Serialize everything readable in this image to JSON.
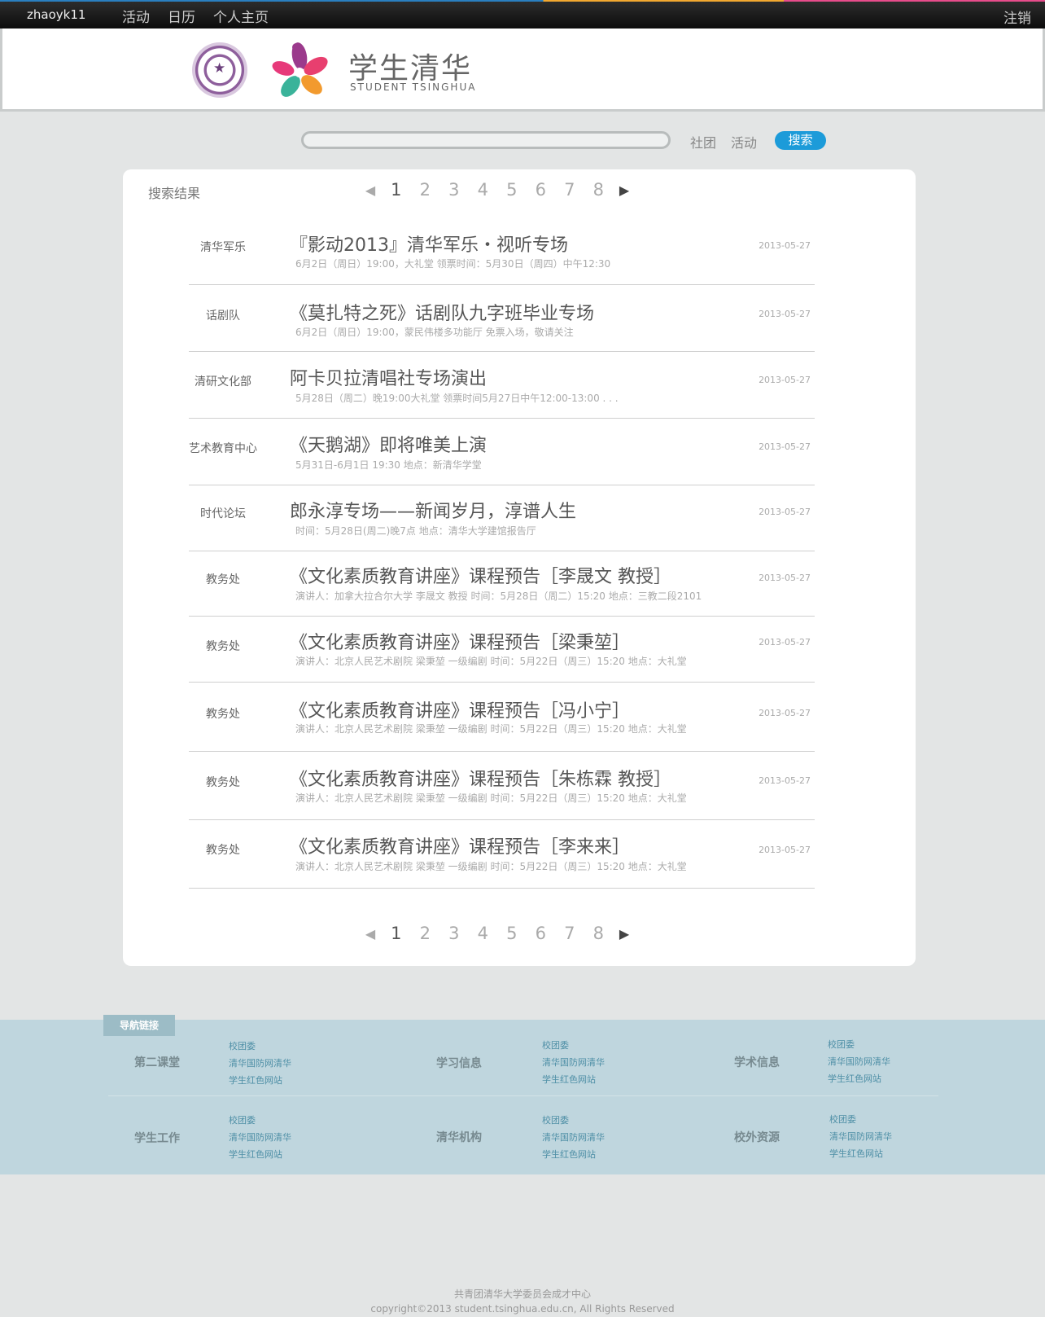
{
  "topbar": {
    "username": "zhaoyk11",
    "nav": [
      "活动",
      "日历",
      "个人主页"
    ],
    "logout": "注销"
  },
  "header": {
    "brand_cn": "学生清华",
    "brand_en": "STUDENT TSINGHUA"
  },
  "search": {
    "value": "",
    "options": [
      "社团",
      "活动"
    ],
    "button": "搜索"
  },
  "results_panel": {
    "title": "搜索结果",
    "pager": {
      "prev": "◀",
      "next": "▶",
      "pages": [
        "1",
        "2",
        "3",
        "4",
        "5",
        "6",
        "7",
        "8"
      ],
      "current": "1"
    },
    "items": [
      {
        "org": "清华军乐",
        "title": "『影动2013』清华军乐・视听专场",
        "desc": "6月2日（周日）19:00，大礼堂  领票时间：5月30日（周四）中午12:30",
        "date": "2013-05-27"
      },
      {
        "org": "话剧队",
        "title": "《莫扎特之死》话剧队九字班毕业专场",
        "desc": "6月2日（周日）19:00，蒙民伟楼多功能厅  免票入场，敬请关注",
        "date": "2013-05-27"
      },
      {
        "org": "清研文化部",
        "title": "阿卡贝拉清唱社专场演出",
        "desc": "5月28日（周二）晚19:00大礼堂  领票时间5月27日中午12:00-13:00 . . .",
        "date": "2013-05-27"
      },
      {
        "org": "艺术教育中心",
        "title": "《天鹅湖》即将唯美上演",
        "desc": "5月31日-6月1日  19:30  地点：新清华学堂",
        "date": "2013-05-27"
      },
      {
        "org": "时代论坛",
        "title": "郎永淳专场——新闻岁月，淳谱人生",
        "desc": "时间：5月28日(周二)晚7点    地点：清华大学建馆报告厅",
        "date": "2013-05-27"
      },
      {
        "org": "教务处",
        "title": "《文化素质教育讲座》课程预告［李晟文  教授］",
        "desc": "演讲人：加拿大拉合尔大学  李晟文  教授  时间：5月28日（周二）15:20  地点：三教二段2101",
        "date": "2013-05-27"
      },
      {
        "org": "教务处",
        "title": "《文化素质教育讲座》课程预告［梁秉堃］",
        "desc": "演讲人：北京人民艺术剧院  梁秉堃  一级编剧  时间：5月22日（周三）15:20  地点：大礼堂",
        "date": "2013-05-27"
      },
      {
        "org": "教务处",
        "title": "《文化素质教育讲座》课程预告［冯小宁］",
        "desc": "演讲人：北京人民艺术剧院  梁秉堃  一级编剧  时间：5月22日（周三）15:20  地点：大礼堂",
        "date": "2013-05-27"
      },
      {
        "org": "教务处",
        "title": "《文化素质教育讲座》课程预告［朱栋霖  教授］",
        "desc": "演讲人：北京人民艺术剧院  梁秉堃  一级编剧  时间：5月22日（周三）15:20  地点：大礼堂",
        "date": "2013-05-27"
      },
      {
        "org": "教务处",
        "title": "《文化素质教育讲座》课程预告［李来来］",
        "desc": "演讲人：北京人民艺术剧院  梁秉堃  一级编剧  时间：5月22日（周三）15:20  地点：大礼堂",
        "date": "2013-05-27"
      }
    ]
  },
  "footer_nav": {
    "tag": "导航链接",
    "groups": [
      {
        "label": "第二课堂",
        "links": [
          "校团委",
          "清华国防网清华",
          "学生红色网站"
        ]
      },
      {
        "label": "学习信息",
        "links": [
          "校团委",
          "清华国防网清华",
          "学生红色网站"
        ]
      },
      {
        "label": "学术信息",
        "links": [
          "校团委",
          "清华国防网清华",
          "学生红色网站"
        ]
      },
      {
        "label": "学生工作",
        "links": [
          "校团委",
          "清华国防网清华",
          "学生红色网站"
        ]
      },
      {
        "label": "清华机构",
        "links": [
          "校团委",
          "清华国防网清华",
          "学生红色网站"
        ]
      },
      {
        "label": "校外资源",
        "links": [
          "校团委",
          "清华国防网清华",
          "学生红色网站"
        ]
      }
    ]
  },
  "copyright": {
    "line1": "共青团清华大学委员会成才中心",
    "line2": "copyright©2013 student.tsinghua.edu.cn, All Rights Reserved"
  },
  "colors": {
    "accent": "#1c9bd9",
    "footer_bg": "#bfd6de"
  }
}
